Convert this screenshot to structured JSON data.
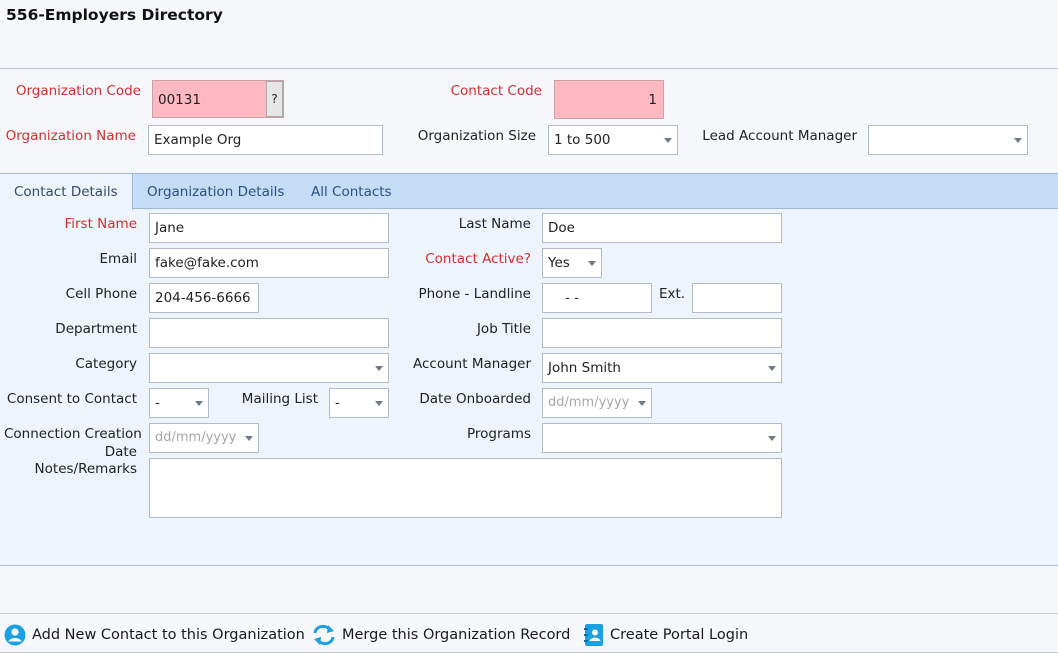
{
  "header": {
    "title": "556-Employers Directory"
  },
  "org": {
    "code_label": "Organization Code",
    "code_value": "00131",
    "code_help": "?",
    "contact_code_label": "Contact Code",
    "contact_code_value": "1",
    "name_label": "Organization Name",
    "name_value": "Example Org",
    "size_label": "Organization Size",
    "size_value": "1 to 500",
    "lead_manager_label": "Lead Account Manager",
    "lead_manager_value": ""
  },
  "tabs": [
    {
      "label": "Contact Details",
      "active": true
    },
    {
      "label": "Organization Details",
      "active": false
    },
    {
      "label": "All Contacts",
      "active": false
    }
  ],
  "contact": {
    "first_name_label": "First Name",
    "first_name_value": "Jane",
    "last_name_label": "Last Name",
    "last_name_value": "Doe",
    "email_label": "Email",
    "email_value": "fake@fake.com",
    "active_label": "Contact Active?",
    "active_value": "Yes",
    "cell_label": "Cell Phone",
    "cell_value": "204-456-6666",
    "landline_label": "Phone - Landline",
    "landline_value": "-   -",
    "ext_label": "Ext.",
    "ext_value": "",
    "department_label": "Department",
    "department_value": "",
    "job_title_label": "Job Title",
    "job_title_value": "",
    "category_label": "Category",
    "category_value": "",
    "account_manager_label": "Account Manager",
    "account_manager_value": "John Smith",
    "consent_label": "Consent to Contact",
    "consent_value": "-",
    "mailing_label": "Mailing List",
    "mailing_value": "-",
    "onboarded_label": "Date Onboarded",
    "onboarded_placeholder": "dd/mm/yyyy",
    "connection_label_1": "Connection Creation",
    "connection_label_2": "Date",
    "connection_placeholder": "dd/mm/yyyy",
    "programs_label": "Programs",
    "programs_value": "",
    "notes_label": "Notes/Remarks",
    "notes_value": ""
  },
  "actions": {
    "add_contact": "Add New Contact to this Organization",
    "merge": "Merge this Organization Record",
    "portal": "Create Portal Login"
  },
  "colors": {
    "required_label": "#d32f2f",
    "key_field_bg": "#fdb8c1",
    "tab_bar_bg": "#c5dcf7",
    "panel_bg": "#eef4fb",
    "icon_accent": "#1ba1e2"
  }
}
